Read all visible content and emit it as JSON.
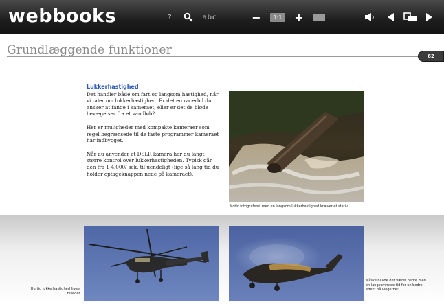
{
  "toolbar": {
    "logo": "webbooks",
    "help_label": "?",
    "abc_label": "abc",
    "minus_label": "−",
    "page_indicator": "1:1",
    "plus_label": "+"
  },
  "page": {
    "chapter_title": "Grundlæggende funktioner",
    "page_number": "62"
  },
  "article": {
    "heading": "Lukkerhastighed",
    "paragraphs": [
      "Det handler både om fart og langsom hastighed, når vi taler om lukkerhastighed. Er det en racerbil du ønsker at fange i kameraet, eller er det de bløde bevægelser fra et vandløb?",
      "Her er muligheder med kompakte kameraer som regel begrænsede til de faste programmer kameraet har indbygget.",
      "Når du anvender et DSLR kamera har du langt større kontrol over lukkerhastigheden. Typisk går den fra 1-4.000/ sek. til uendeligt (lige så lang tid du holder optageknappen nede på kameraet)."
    ]
  },
  "captions": {
    "waterfall": "Motiv fotograferet med en langsom lukkerhastighed kræver et stativ.",
    "heli_fast": "Hurtig lukkerhastighed fryser billedet.",
    "heli_slow": "Måske havde det været bedre med en langsommere tid for en bedre effekt på vingerne!"
  },
  "colors": {
    "toolbar_bg": "#1e1e1e",
    "heading_blue": "#2a59b8",
    "title_grey": "#8a8a8a"
  },
  "icons": {
    "search": "search-icon",
    "audio": "speaker-icon",
    "prev": "triangle-left-icon",
    "layout": "two-page-layout-icon",
    "next": "triangle-right-icon"
  }
}
